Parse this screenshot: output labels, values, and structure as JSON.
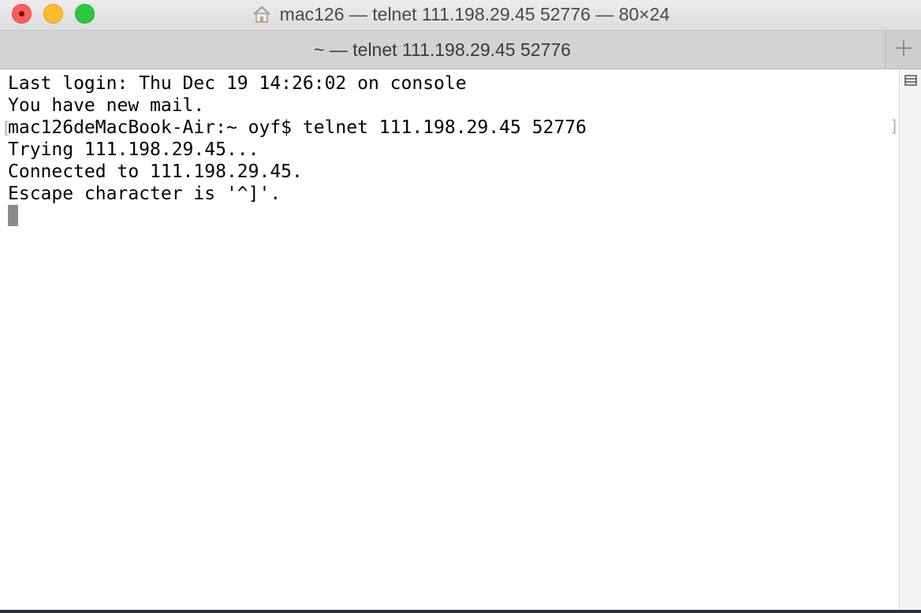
{
  "window": {
    "title": "mac126 — telnet 111.198.29.45 52776 — 80×24"
  },
  "tab": {
    "label": "~ — telnet 111.198.29.45 52776"
  },
  "terminal": {
    "lines": [
      "Last login: Thu Dec 19 14:26:02 on console",
      "You have new mail.",
      "mac126deMacBook-Air:~ oyf$ telnet 111.198.29.45 52776",
      "Trying 111.198.29.45...",
      "Connected to 111.198.29.45.",
      "Escape character is '^]'."
    ]
  },
  "icons": {
    "home": "home-icon",
    "new_tab": "plus-icon",
    "split": "split-pane-icon"
  },
  "colors": {
    "close": "#fc5f57",
    "minimize": "#fdbc2e",
    "maximize": "#29c940"
  }
}
